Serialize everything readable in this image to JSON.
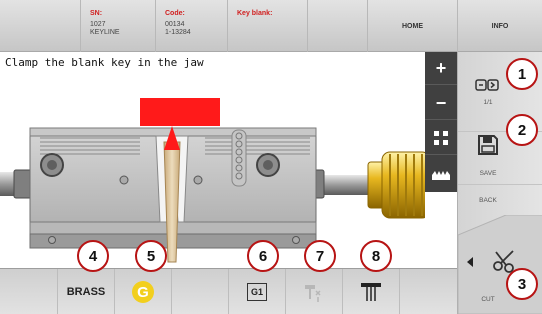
{
  "header": {
    "sn_label": "SN:",
    "sn_values": [
      "1027",
      "KEYLINE"
    ],
    "code_label": "Code:",
    "code_values": [
      "00134",
      "1-13284"
    ],
    "key_blank_label": "Key blank:",
    "home_label": "HOME",
    "info_label": "INFO"
  },
  "instruction": "Clamp the blank key in the jaw",
  "toolbar": {
    "items": [
      {
        "icon": "plus-icon",
        "label": "+"
      },
      {
        "icon": "minus-icon",
        "label": "−"
      },
      {
        "icon": "fullscreen-icon",
        "label": "⛶"
      },
      {
        "icon": "profile-icon",
        "label": ""
      }
    ]
  },
  "side_panel": {
    "page_indicator": "1/1",
    "save_label": "SAVE",
    "back_label": "BACK",
    "cut_label": "CUT"
  },
  "bottom": {
    "material_label": "BRASS",
    "g_badge": "G",
    "gbox_label": "G1"
  },
  "callouts": [
    "1",
    "2",
    "3",
    "4",
    "5",
    "6",
    "7",
    "8"
  ],
  "colors": {
    "accent_red": "#d12020",
    "callout_border": "#b71414",
    "key_red": "#ff1a1a",
    "knob_gold": "#e8b820",
    "g_yellow": "#f2cf1e"
  }
}
